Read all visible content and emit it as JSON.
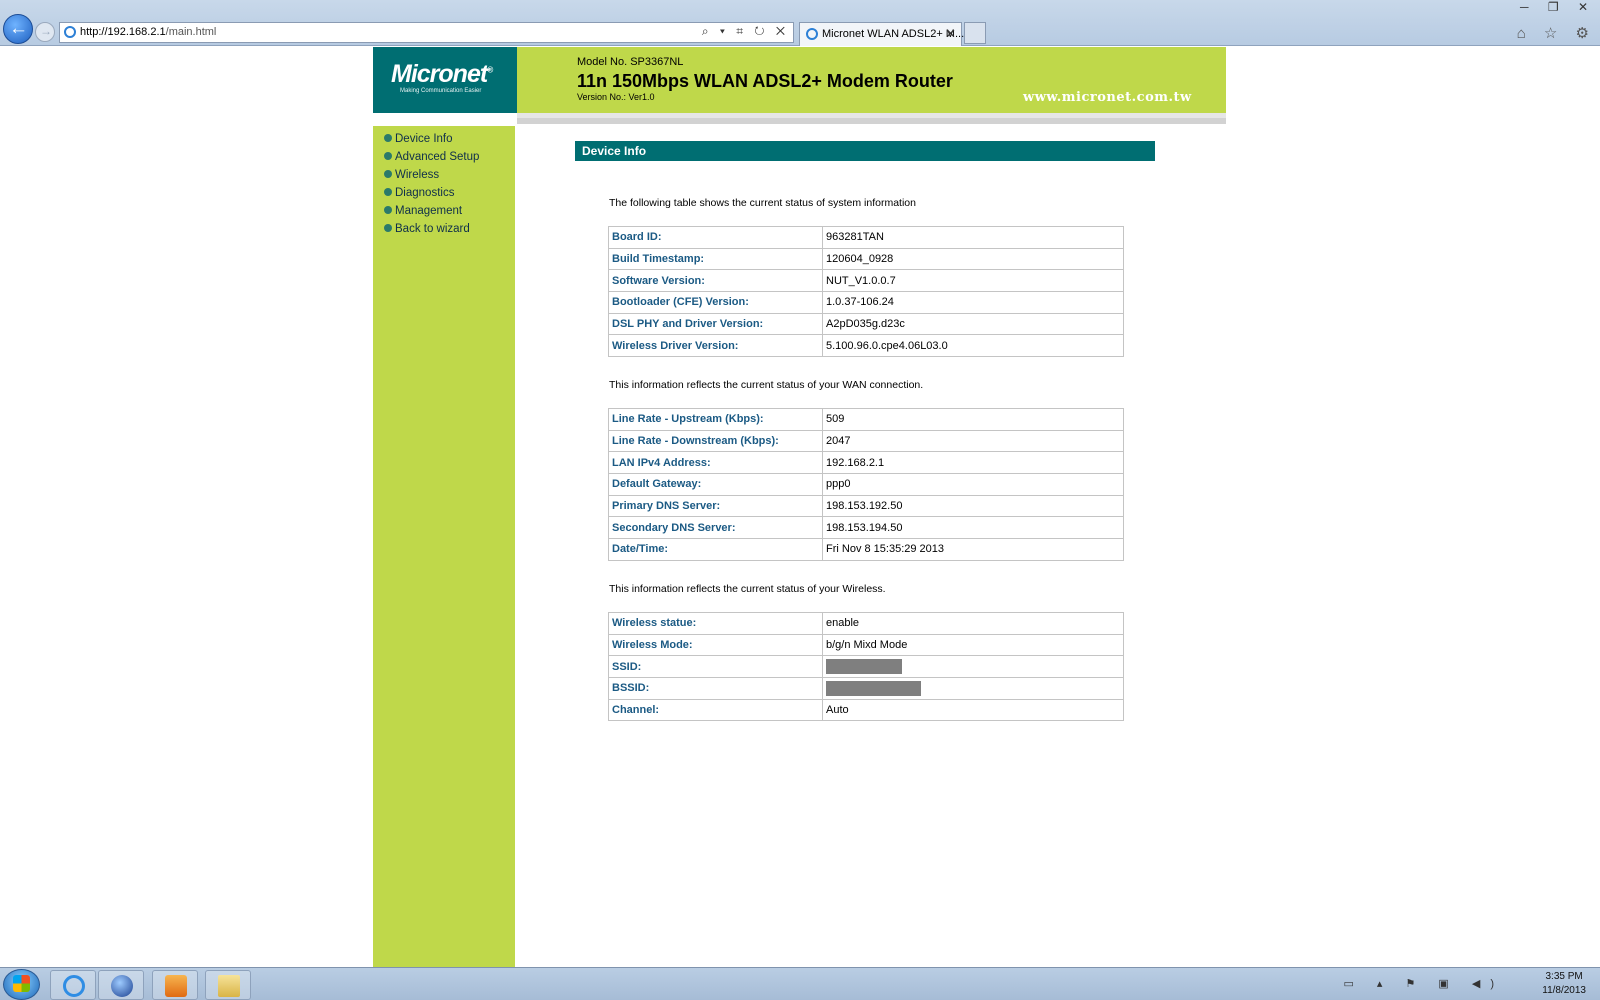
{
  "browser": {
    "url_host": "http://192.168.2.1",
    "url_path": "/main.html",
    "tab_title": "Micronet WLAN ADSL2+ M...",
    "address_actions": "⌕ ▾ ⌗ ↻ ✕",
    "window_controls": "─ ❐ ✕",
    "tools": "⌂ ☆ ⚙"
  },
  "header": {
    "logo": "Micronet",
    "logo_mark": "®",
    "logo_tagline": "Making Communication Easier",
    "model_no": "Model No. SP3367NL",
    "product_title": "11n 150Mbps WLAN  ADSL2+ Modem Router",
    "version_no": "Version No.: Ver1.0",
    "website": "www.micronet.com.tw"
  },
  "nav": {
    "items": [
      {
        "label": "Device Info"
      },
      {
        "label": "Advanced Setup"
      },
      {
        "label": "Wireless"
      },
      {
        "label": "Diagnostics"
      },
      {
        "label": "Management"
      },
      {
        "label": "Back to wizard"
      }
    ]
  },
  "main": {
    "section_title": "Device Info",
    "system_intro": "The following table shows the current status of system information",
    "system_rows": [
      {
        "key": "Board ID:",
        "value": "963281TAN"
      },
      {
        "key": "Build Timestamp:",
        "value": "120604_0928"
      },
      {
        "key": "Software Version:",
        "value": "NUT_V1.0.0.7"
      },
      {
        "key": "Bootloader (CFE) Version:",
        "value": "1.0.37-106.24"
      },
      {
        "key": "DSL PHY and Driver Version:",
        "value": "A2pD035g.d23c"
      },
      {
        "key": "Wireless Driver Version:",
        "value": "5.100.96.0.cpe4.06L03.0"
      }
    ],
    "wan_intro": "This information reflects the current status of your WAN connection.",
    "wan_rows": [
      {
        "key": "Line Rate - Upstream (Kbps):",
        "value": "509"
      },
      {
        "key": "Line Rate - Downstream (Kbps):",
        "value": "2047"
      },
      {
        "key": "LAN IPv4 Address:",
        "value": "192.168.2.1"
      },
      {
        "key": "Default Gateway:",
        "value": "ppp0"
      },
      {
        "key": "Primary DNS Server:",
        "value": "198.153.192.50"
      },
      {
        "key": "Secondary DNS Server:",
        "value": "198.153.194.50"
      },
      {
        "key": "Date/Time:",
        "value": "Fri Nov 8 15:35:29 2013"
      }
    ],
    "wireless_intro": "This information reflects the current status of your Wireless.",
    "wireless_rows": [
      {
        "key": "Wireless statue:",
        "value": "enable"
      },
      {
        "key": "Wireless Mode:",
        "value": "b/g/n Mixd Mode"
      },
      {
        "key": "SSID:",
        "value": ""
      },
      {
        "key": "BSSID:",
        "value": ""
      },
      {
        "key": "Channel:",
        "value": "Auto"
      }
    ]
  },
  "taskbar": {
    "tray_icons": "▭ ▴ ⚑ ▣ ◀)",
    "time": "3:35 PM",
    "date": "11/8/2013"
  },
  "colors": {
    "brand_teal": "#006e72",
    "brand_lime": "#bfd84a",
    "label_blue": "#1b5a84"
  }
}
